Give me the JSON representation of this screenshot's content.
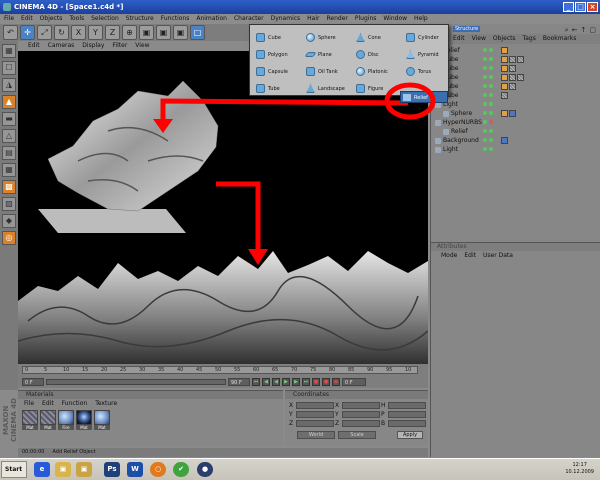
{
  "window": {
    "title": "CINEMA 4D - [Space1.c4d *]"
  },
  "menubar": [
    "File",
    "Edit",
    "Objects",
    "Tools",
    "Selection",
    "Structure",
    "Functions",
    "Animation",
    "Character",
    "Dynamics",
    "Hair",
    "Render",
    "Plugins",
    "Window",
    "Help"
  ],
  "toolbar": {
    "undo": "↶",
    "move": "✛",
    "scale": "⤢",
    "rotate": "↻",
    "x": "X",
    "y": "Y",
    "z": "Z",
    "world": "⊕",
    "render_view": "▣",
    "render_pic": "▣",
    "render_settings": "▣",
    "cube": "□"
  },
  "left_tools": [
    "▦",
    "☐",
    "◮",
    "▲",
    "▬",
    "△",
    "▤",
    "▦",
    "▩",
    "▨",
    "◆",
    "◎"
  ],
  "viewport": {
    "menu": [
      "Edit",
      "Cameras",
      "Display",
      "Filter",
      "View"
    ]
  },
  "primitives_popup": {
    "items": [
      "Cube",
      "Sphere",
      "Cone",
      "Cylinder",
      "Polygon",
      "Plane",
      "Disc",
      "Pyramid",
      "Capsule",
      "Oil Tank",
      "Platonic",
      "Torus",
      "Tube",
      "Landscape",
      "Figure",
      "Relief"
    ],
    "highlighted": "Relief"
  },
  "objects_panel": {
    "tab_label": "Structure",
    "menu": [
      "Edit",
      "View",
      "Objects",
      "Tags",
      "Bookmarks"
    ],
    "rows": [
      {
        "name": "Relief",
        "indent": 0
      },
      {
        "name": "Cube",
        "indent": 0
      },
      {
        "name": "Cube",
        "indent": 0
      },
      {
        "name": "Cube",
        "indent": 0
      },
      {
        "name": "Cube",
        "indent": 0
      },
      {
        "name": "Cube",
        "indent": 0
      },
      {
        "name": "Light",
        "indent": 0
      },
      {
        "name": "Sphere",
        "indent": 1
      },
      {
        "name": "HyperNURBS",
        "indent": 0
      },
      {
        "name": "Relief",
        "indent": 1
      },
      {
        "name": "Background",
        "indent": 0
      },
      {
        "name": "Light",
        "indent": 0
      }
    ]
  },
  "attributes_panel": {
    "title": "Attributes",
    "menu": [
      "Mode",
      "Edit",
      "User Data"
    ]
  },
  "timeline": {
    "ticks": [
      "0",
      "5",
      "10",
      "15",
      "20",
      "25",
      "30",
      "35",
      "40",
      "45",
      "50",
      "55",
      "60",
      "65",
      "70",
      "75",
      "80",
      "85",
      "90",
      "95",
      "10"
    ],
    "start_field": "0 F",
    "end_field": "90 F",
    "current_field": "0 F",
    "play_buttons": [
      "⏮",
      "◀",
      "◀",
      "▶",
      "▶",
      "⏭"
    ],
    "record_buttons": [
      "●",
      "●",
      "◉"
    ]
  },
  "materials_panel": {
    "title": "Materials",
    "menu": [
      "File",
      "Edit",
      "Function",
      "Texture"
    ],
    "materials": [
      "Mat",
      "Mat",
      "Fire",
      "Mat",
      "Mat"
    ]
  },
  "coordinates_panel": {
    "title": "Coordinates",
    "axes": [
      "X",
      "Y",
      "Z"
    ],
    "col2": [
      "X",
      "Y",
      "Z"
    ],
    "col3": [
      "H",
      "P",
      "B"
    ],
    "dropdown1": "World",
    "dropdown2": "Scale",
    "apply": "Apply"
  },
  "status": {
    "time": "00:00:00",
    "message": "Add Relief Object"
  },
  "brand": "MAXON CINEMA 4D",
  "taskbar": {
    "start_label": "Start",
    "apps": [
      "e",
      "▣",
      "▣",
      "Ps",
      "W",
      "○",
      "✔",
      "●"
    ],
    "clock_time": "12:17",
    "clock_date": "10.12.2009"
  },
  "annotation": {
    "color": "#ff0000"
  }
}
